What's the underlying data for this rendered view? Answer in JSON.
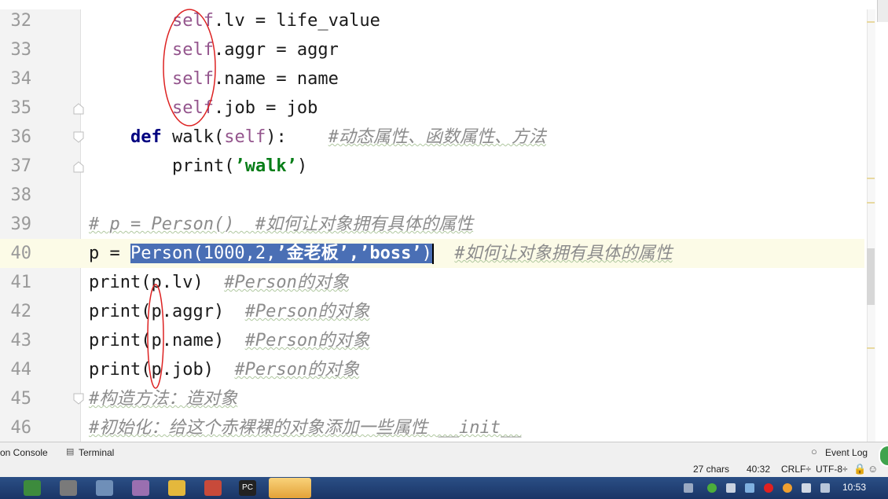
{
  "editor": {
    "current_line": "40",
    "lines": [
      {
        "num": "32",
        "indent": "        ",
        "tokens": [
          {
            "t": "self",
            "c": "slf"
          },
          {
            "t": ".lv = life_value",
            "c": ""
          }
        ]
      },
      {
        "num": "33",
        "indent": "        ",
        "tokens": [
          {
            "t": "self",
            "c": "slf"
          },
          {
            "t": ".aggr = aggr",
            "c": ""
          }
        ]
      },
      {
        "num": "34",
        "indent": "        ",
        "tokens": [
          {
            "t": "self",
            "c": "slf"
          },
          {
            "t": ".name = name",
            "c": ""
          }
        ]
      },
      {
        "num": "35",
        "indent": "        ",
        "tokens": [
          {
            "t": "self",
            "c": "slf"
          },
          {
            "t": ".job = job",
            "c": ""
          }
        ]
      },
      {
        "num": "36",
        "indent": "    ",
        "tokens": [
          {
            "t": "def",
            "c": "kw"
          },
          {
            "t": " walk(",
            "c": ""
          },
          {
            "t": "self",
            "c": "slf"
          },
          {
            "t": "):    ",
            "c": ""
          },
          {
            "t": "#动态属性、函数属性、方法",
            "c": "cmt"
          }
        ]
      },
      {
        "num": "37",
        "indent": "        ",
        "tokens": [
          {
            "t": "print(",
            "c": ""
          },
          {
            "t": "’walk’",
            "c": "str"
          },
          {
            "t": ")",
            "c": ""
          }
        ]
      },
      {
        "num": "38",
        "indent": "",
        "tokens": []
      },
      {
        "num": "39",
        "indent": "",
        "tokens": [
          {
            "t": "# p = Person()  #如何让对象拥有具体的属性",
            "c": "cmt"
          }
        ]
      },
      {
        "num": "40",
        "indent": "",
        "tokens": [
          {
            "t": "p = ",
            "c": ""
          },
          {
            "t": "Person(1000,2,",
            "c": "sel"
          },
          {
            "t": "’金老板’,’boss’",
            "c": "sel str"
          },
          {
            "t": ")",
            "c": "sel"
          },
          {
            "t": "  ",
            "c": ""
          },
          {
            "t": "#如何让对象拥有具体的属性",
            "c": "cmt"
          }
        ]
      },
      {
        "num": "41",
        "indent": "",
        "tokens": [
          {
            "t": "print(p.lv)  ",
            "c": ""
          },
          {
            "t": "#Person的对象",
            "c": "cmt"
          }
        ]
      },
      {
        "num": "42",
        "indent": "",
        "tokens": [
          {
            "t": "print(p.aggr)  ",
            "c": ""
          },
          {
            "t": "#Person的对象",
            "c": "cmt"
          }
        ]
      },
      {
        "num": "43",
        "indent": "",
        "tokens": [
          {
            "t": "print(p.name)  ",
            "c": ""
          },
          {
            "t": "#Person的对象",
            "c": "cmt"
          }
        ]
      },
      {
        "num": "44",
        "indent": "",
        "tokens": [
          {
            "t": "print(p.job)  ",
            "c": ""
          },
          {
            "t": "#Person的对象",
            "c": "cmt"
          }
        ]
      },
      {
        "num": "45",
        "indent": "",
        "tokens": [
          {
            "t": "#构造方法：造对象",
            "c": "cmt"
          }
        ]
      },
      {
        "num": "46",
        "indent": "",
        "tokens": [
          {
            "t": "#初始化：给这个赤裸裸的对象添加一些属性 __init__",
            "c": "cmt"
          }
        ]
      }
    ]
  },
  "tool_tabs": {
    "console_label": "on Console",
    "terminal_label": "Terminal",
    "event_log_label": "Event Log"
  },
  "status": {
    "chars": "27 chars",
    "position": "40:32",
    "line_sep": "CRLF÷",
    "encoding": "UTF-8÷"
  },
  "taskbar": {
    "clock": "10:53"
  },
  "colors": {
    "selection": "#4a6fb5",
    "annotation_red": "#d22"
  }
}
